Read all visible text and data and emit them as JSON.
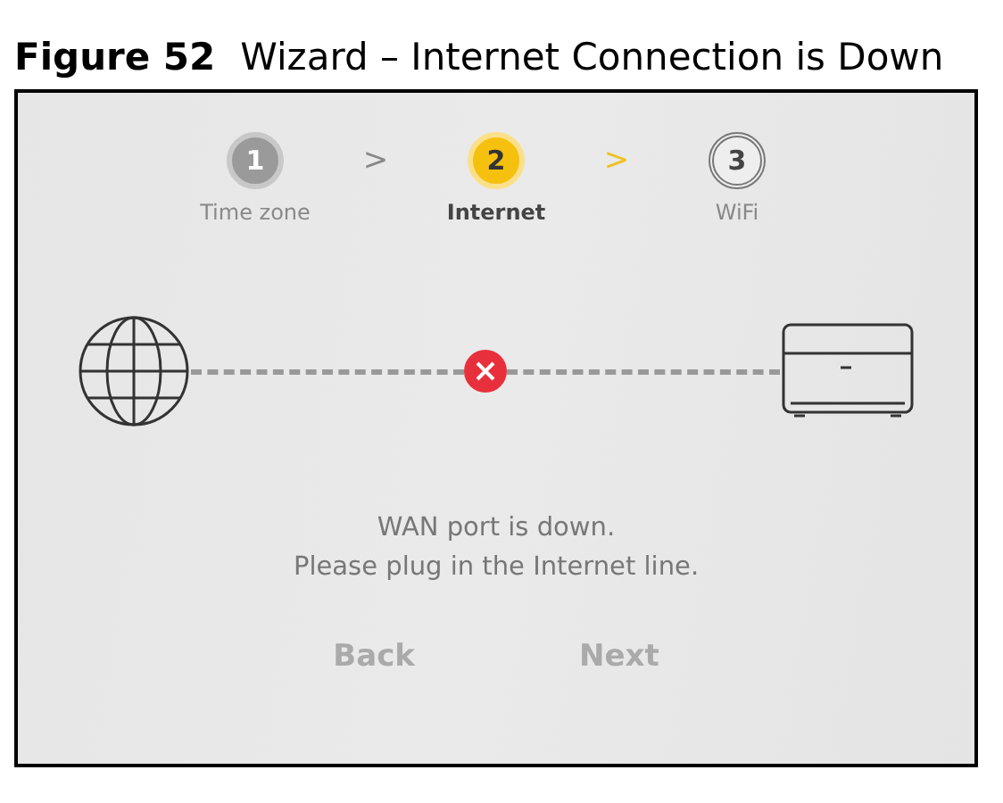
{
  "caption": {
    "number": "Figure 52",
    "title": "Wizard – Internet Connection is Down"
  },
  "steps": [
    {
      "number": "1",
      "label": "Time zone",
      "kind": "done"
    },
    {
      "number": "2",
      "label": "Internet",
      "kind": "current",
      "separator": ">"
    },
    {
      "number": "3",
      "label": "WiFi",
      "kind": "pending",
      "separator": ">"
    }
  ],
  "connection": {
    "down": true
  },
  "message": [
    "WAN port is down.",
    "Please plug in the Internet line."
  ],
  "buttons": [
    {
      "label": "Back",
      "disabled": true
    },
    {
      "label": "Next",
      "disabled": true
    }
  ]
}
